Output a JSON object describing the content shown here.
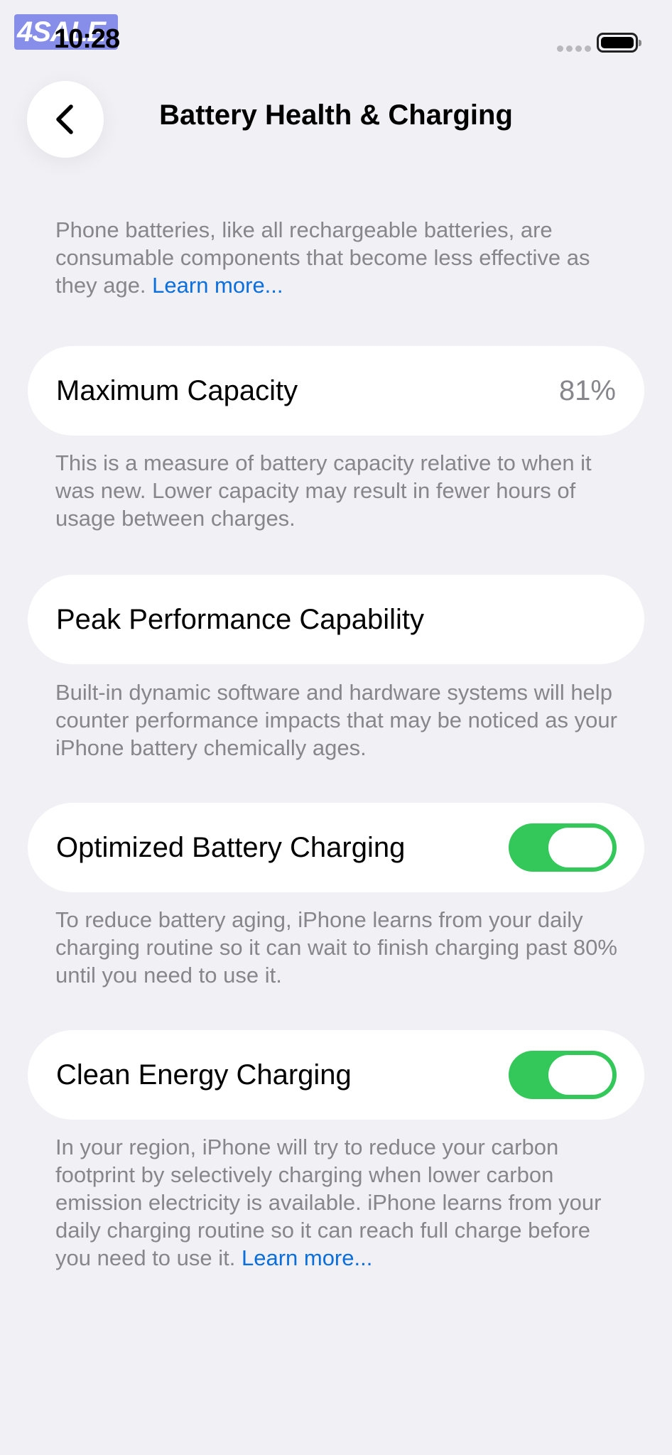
{
  "status_bar": {
    "watermark": "4SALE",
    "time": "10:28"
  },
  "nav": {
    "back_icon": "chevron-left-icon",
    "title": "Battery Health & Charging"
  },
  "intro": {
    "text": "Phone batteries, like all rechargeable batteries, are consumable components that become less effective as they age. ",
    "link": "Learn more..."
  },
  "maximum_capacity": {
    "label": "Maximum Capacity",
    "value": "81%",
    "footnote": "This is a measure of battery capacity relative to when it was new. Lower capacity may result in fewer hours of usage between charges."
  },
  "peak_performance": {
    "label": "Peak Performance Capability",
    "footnote": "Built-in dynamic software and hardware systems will help counter performance impacts that may be noticed as your iPhone battery chemically ages."
  },
  "optimized_charging": {
    "label": "Optimized Battery Charging",
    "enabled": true,
    "footnote": "To reduce battery aging, iPhone learns from your daily charging routine so it can wait to finish charging past 80% until you need to use it."
  },
  "clean_energy": {
    "label": "Clean Energy Charging",
    "enabled": true,
    "footnote": "In your region, iPhone will try to reduce your carbon footprint by selectively charging when lower carbon emission electricity is available. iPhone learns from your daily charging routine so it can reach full charge before you need to use it. ",
    "link": "Learn more..."
  },
  "colors": {
    "background": "#f0f0f5",
    "toggle_on": "#34c759",
    "link": "#0a6fdc",
    "secondary_text": "#86868b"
  }
}
